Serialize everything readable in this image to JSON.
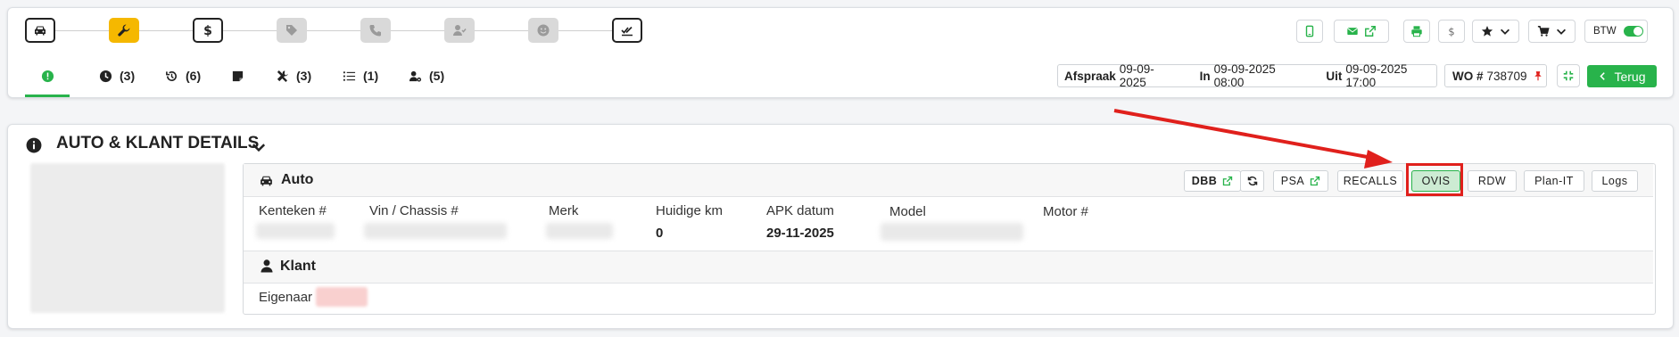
{
  "workflow": {
    "steps": [
      {
        "icon": "car-icon",
        "state": "active"
      },
      {
        "icon": "wrench-icon",
        "state": "current"
      },
      {
        "icon": "dollar-icon",
        "state": "active"
      },
      {
        "icon": "tag-icon",
        "state": "inactive"
      },
      {
        "icon": "phone-icon",
        "state": "inactive"
      },
      {
        "icon": "user-check-icon",
        "state": "inactive"
      },
      {
        "icon": "smiley-icon",
        "state": "inactive"
      },
      {
        "icon": "double-check-icon",
        "state": "active"
      }
    ]
  },
  "tabs": [
    {
      "icon": "alert-icon",
      "count": ""
    },
    {
      "icon": "clock-icon",
      "count": "(3)"
    },
    {
      "icon": "history-icon",
      "count": "(6)"
    },
    {
      "icon": "note-icon",
      "count": ""
    },
    {
      "icon": "tools-icon",
      "count": "(3)"
    },
    {
      "icon": "list-icon",
      "count": "(1)"
    },
    {
      "icon": "user-cog-icon",
      "count": "(5)"
    }
  ],
  "toolbar": {
    "btw_label": "BTW",
    "btw_on": true
  },
  "appointment": {
    "afspraak_label": "Afspraak",
    "afspraak_value": "09-09-2025",
    "in_label": "In",
    "in_value": "09-09-2025 08:00",
    "uit_label": "Uit",
    "uit_value": "09-09-2025 17:00",
    "wo_label": "WO #",
    "wo_value": "738709",
    "back_label": "Terug"
  },
  "section": {
    "title": "AUTO & KLANT DETAILS"
  },
  "auto": {
    "title": "Auto",
    "buttons": {
      "dbb": "DBB",
      "psa": "PSA",
      "recalls": "RECALLS",
      "ovis": "OVIS",
      "rdw": "RDW",
      "planit": "Plan-IT",
      "logs": "Logs"
    },
    "fields": {
      "kenteken_label": "Kenteken #",
      "vin_label": "Vin / Chassis #",
      "merk_label": "Merk",
      "km_label": "Huidige km",
      "km_value": "0",
      "apk_label": "APK datum",
      "apk_value": "29-11-2025",
      "model_label": "Model",
      "motor_label": "Motor #"
    }
  },
  "klant": {
    "title": "Klant",
    "eigenaar_label": "Eigenaar"
  },
  "colors": {
    "accent_green": "#28b34b",
    "step_current": "#f5b800",
    "annotation_red": "#e0201c"
  }
}
